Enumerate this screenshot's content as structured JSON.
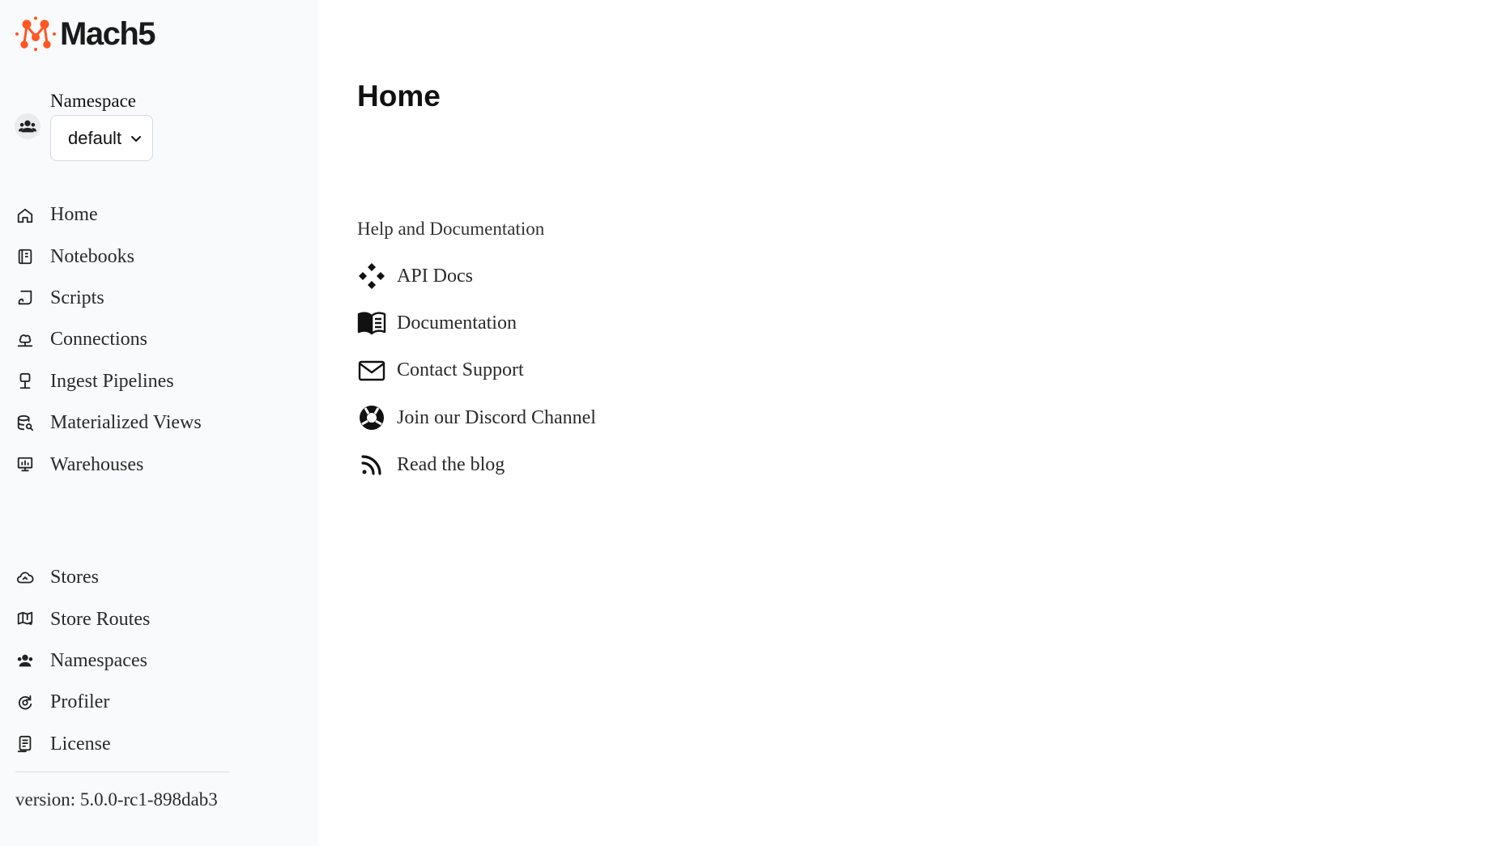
{
  "brand": {
    "name": "Mach5",
    "accent_color": "#ff5722"
  },
  "namespace": {
    "label": "Namespace",
    "selected": "default",
    "icon": "users-icon"
  },
  "nav_top": [
    {
      "label": "Home",
      "icon": "home-icon"
    },
    {
      "label": "Notebooks",
      "icon": "notebook-icon"
    },
    {
      "label": "Scripts",
      "icon": "script-icon"
    },
    {
      "label": "Connections",
      "icon": "connections-icon"
    },
    {
      "label": "Ingest Pipelines",
      "icon": "pipeline-icon"
    },
    {
      "label": "Materialized Views",
      "icon": "database-search-icon"
    },
    {
      "label": "Warehouses",
      "icon": "warehouse-icon"
    }
  ],
  "nav_bottom": [
    {
      "label": "Stores",
      "icon": "cloud-icon"
    },
    {
      "label": "Store Routes",
      "icon": "map-icon"
    },
    {
      "label": "Namespaces",
      "icon": "users-icon"
    },
    {
      "label": "Profiler",
      "icon": "profiler-icon"
    },
    {
      "label": "License",
      "icon": "license-icon"
    }
  ],
  "version": "version: 5.0.0-rc1-898dab3",
  "main": {
    "title": "Home",
    "help_heading": "Help and Documentation",
    "help_links": [
      {
        "label": "API Docs",
        "icon": "api-icon"
      },
      {
        "label": "Documentation",
        "icon": "book-icon"
      },
      {
        "label": "Contact Support",
        "icon": "mail-icon"
      },
      {
        "label": "Join our Discord Channel",
        "icon": "lifebuoy-icon"
      },
      {
        "label": "Read the blog",
        "icon": "rss-icon"
      }
    ]
  }
}
